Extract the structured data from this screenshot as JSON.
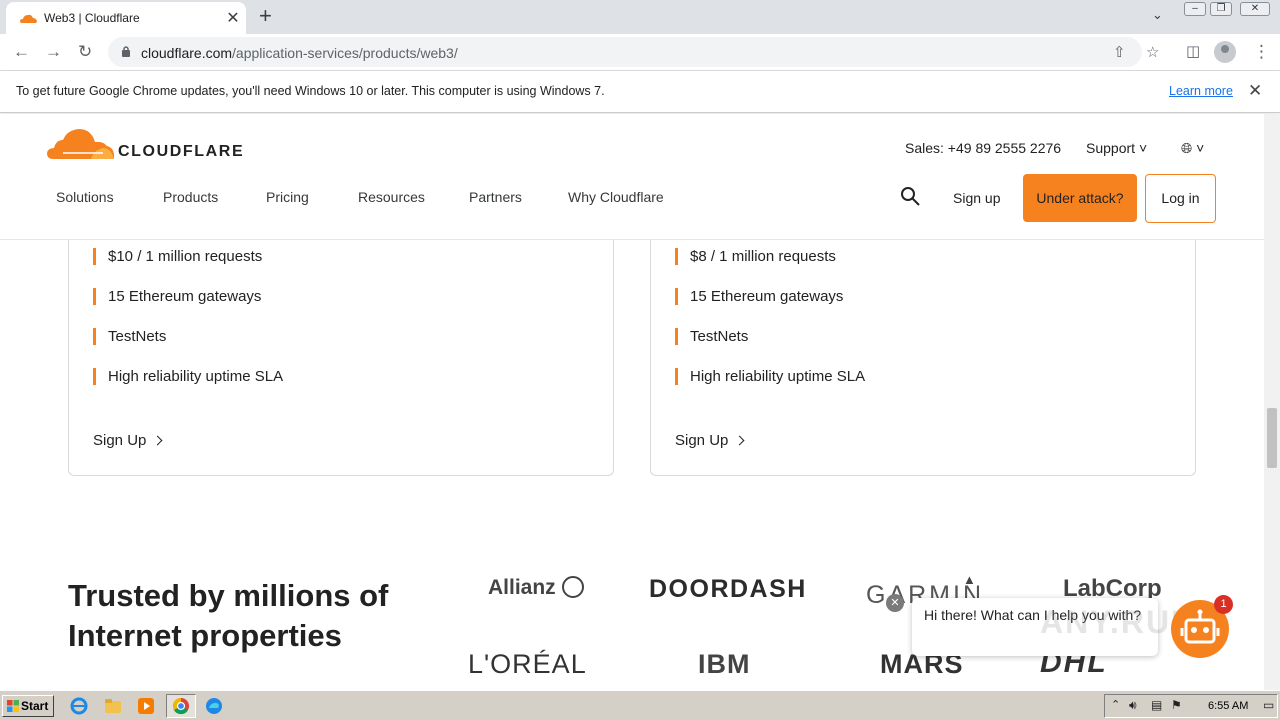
{
  "browser": {
    "tab_title": "Web3 | Cloudflare",
    "tab_close": "✕",
    "new_tab": "+",
    "url_host": "cloudflare.com",
    "url_path": "/application-services/products/web3/",
    "window_minimize": "–",
    "window_restore": "❐",
    "window_close": "✕"
  },
  "infobar": {
    "message": "To get future Google Chrome updates, you'll need Windows 10 or later. This computer is using Windows 7.",
    "link": "Learn more",
    "close": "✕"
  },
  "site": {
    "brand": "CLOUDFLARE",
    "sales": "Sales: +49 89 2555 2276",
    "support": "Support",
    "nav": [
      "Solutions",
      "Products",
      "Pricing",
      "Resources",
      "Partners",
      "Why Cloudflare"
    ],
    "signup": "Sign up",
    "under_attack": "Under attack?",
    "login": "Log in",
    "accent": "#f6821f"
  },
  "cards": [
    {
      "features": [
        "$10 / 1 million requests",
        "15 Ethereum gateways",
        "TestNets",
        "High reliability uptime SLA"
      ],
      "cta": "Sign Up"
    },
    {
      "features": [
        "$8 / 1 million requests",
        "15 Ethereum gateways",
        "TestNets",
        "High reliability uptime SLA"
      ],
      "cta": "Sign Up"
    }
  ],
  "trusted": {
    "title": "Trusted by millions of Internet properties",
    "logos": [
      "Allianz",
      "DOORDASH",
      "GARMIN",
      "LabCorp",
      "L'ORÉAL",
      "IBM",
      "MARS",
      "DHL"
    ]
  },
  "chat": {
    "message": "Hi there! What can I help you with?",
    "badge": "1",
    "close": "✕",
    "watermark": "ANY.RUN"
  },
  "taskbar": {
    "start": "Start",
    "clock": "6:55 AM"
  }
}
